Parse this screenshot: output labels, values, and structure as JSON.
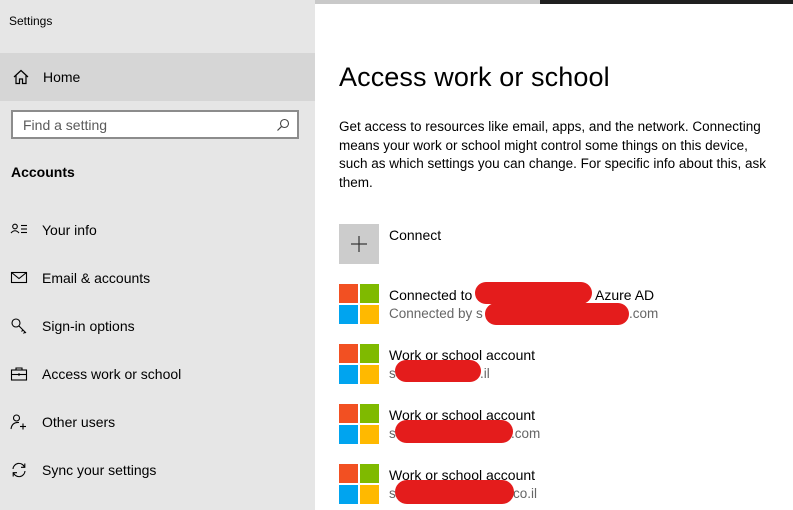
{
  "window": {
    "title": "Settings"
  },
  "sidebar": {
    "home_label": "Home",
    "search_placeholder": "Find a setting",
    "section_title": "Accounts",
    "items": [
      {
        "label": "Your info",
        "icon": "person-card-icon"
      },
      {
        "label": "Email & accounts",
        "icon": "mail-icon"
      },
      {
        "label": "Sign-in options",
        "icon": "key-icon"
      },
      {
        "label": "Access work or school",
        "icon": "briefcase-icon"
      },
      {
        "label": "Other users",
        "icon": "add-person-icon"
      },
      {
        "label": "Sync your settings",
        "icon": "sync-icon"
      }
    ]
  },
  "main": {
    "title": "Access work or school",
    "description": "Get access to resources like email, apps, and the network. Connecting means your work or school might control some things on this device, such as which settings you can change. For specific info about this, ask them.",
    "connect_label": "Connect",
    "accounts": [
      {
        "line1_prefix": "Connected to",
        "line1_suffix": "Azure AD",
        "line2_prefix": "Connected by s",
        "line2_suffix": ".com"
      },
      {
        "line1": "Work or school account",
        "line2_prefix": "s",
        "line2_suffix": ".il"
      },
      {
        "line1": "Work or school account",
        "line2_prefix": "s",
        "line2_suffix": ".com"
      },
      {
        "line1": "Work or school account",
        "line2_prefix": "s",
        "line2_suffix": "co.il"
      }
    ]
  },
  "colors": {
    "sidebar_bg": "#e6e6e6",
    "home_bg": "#d6d6d6",
    "ms_red": "#f25022",
    "ms_green": "#7fba00",
    "ms_blue": "#00a4ef",
    "ms_yellow": "#ffb900",
    "redaction": "#e41c1c"
  }
}
